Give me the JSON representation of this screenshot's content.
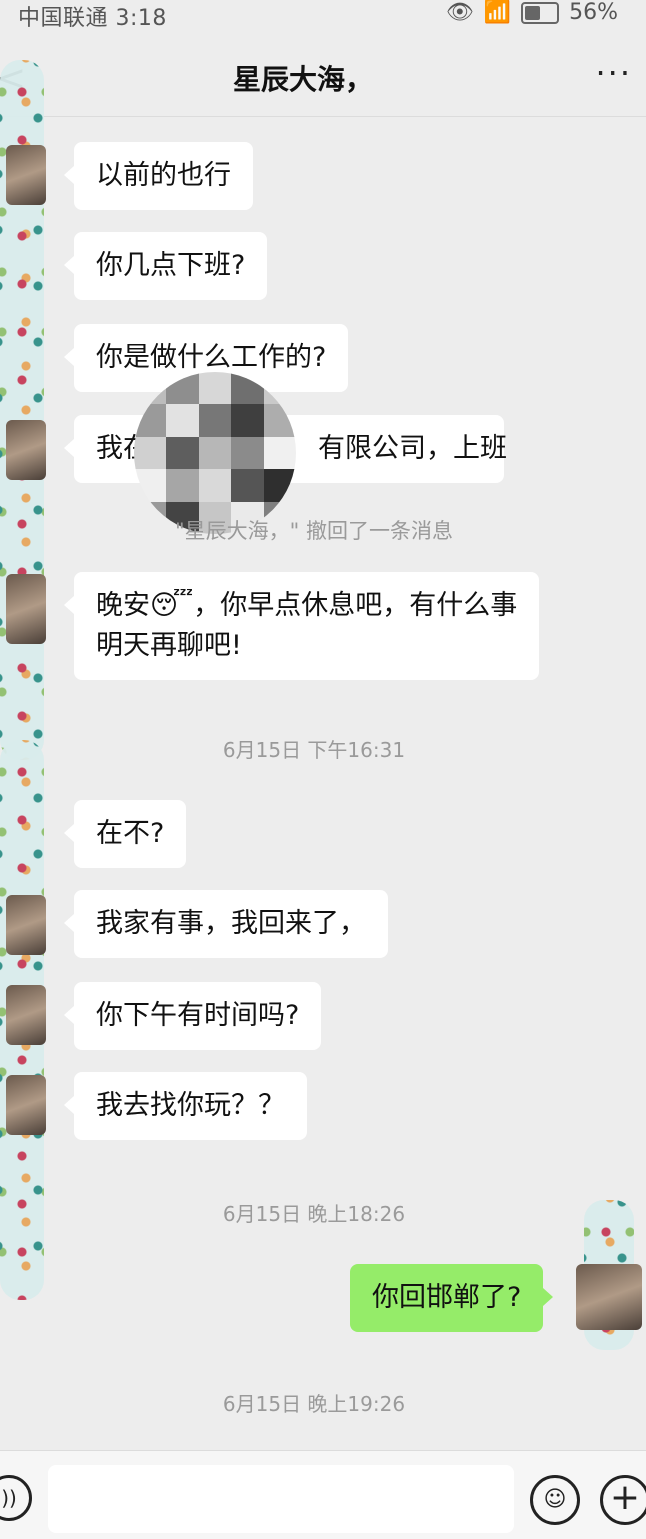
{
  "status_bar": {
    "carrier_time": "中国联通 3:18",
    "battery": "56%",
    "icons": [
      "eye-icon",
      "wifi-icon",
      "signal-icon",
      "battery-icon"
    ]
  },
  "nav": {
    "back": "<",
    "title": "星辰大海，",
    "more": "···"
  },
  "messages": {
    "m1": "以前的也行",
    "m2": "你几点下班?",
    "m3": "你是做什么工作的?",
    "m4_prefix": "我在",
    "m4_suffix": "有限公司，上班",
    "recall": "\"星辰大海，\" 撤回了一条消息",
    "m5_line1": "晚安😴，你早点休息吧，有什么事",
    "m5_line2": "明天再聊吧!",
    "time1": "6月15日 下午16:31",
    "m6": "在不?",
    "m7": "我家有事，我回来了，",
    "m8": "你下午有时间吗?",
    "m9": "我去找你玩？？",
    "time2": "6月15日 晚上18:26",
    "m10": "你回邯郸了?",
    "time3": "6月15日 晚上19:26"
  },
  "input_bar": {
    "voice_icon": "voice-icon",
    "emoji_icon": "emoji-icon",
    "plus_icon": "plus-icon"
  },
  "colors": {
    "background": "#ededed",
    "bubble_left": "#ffffff",
    "bubble_right": "#95ec69",
    "timestamp": "#9a9a9a"
  }
}
